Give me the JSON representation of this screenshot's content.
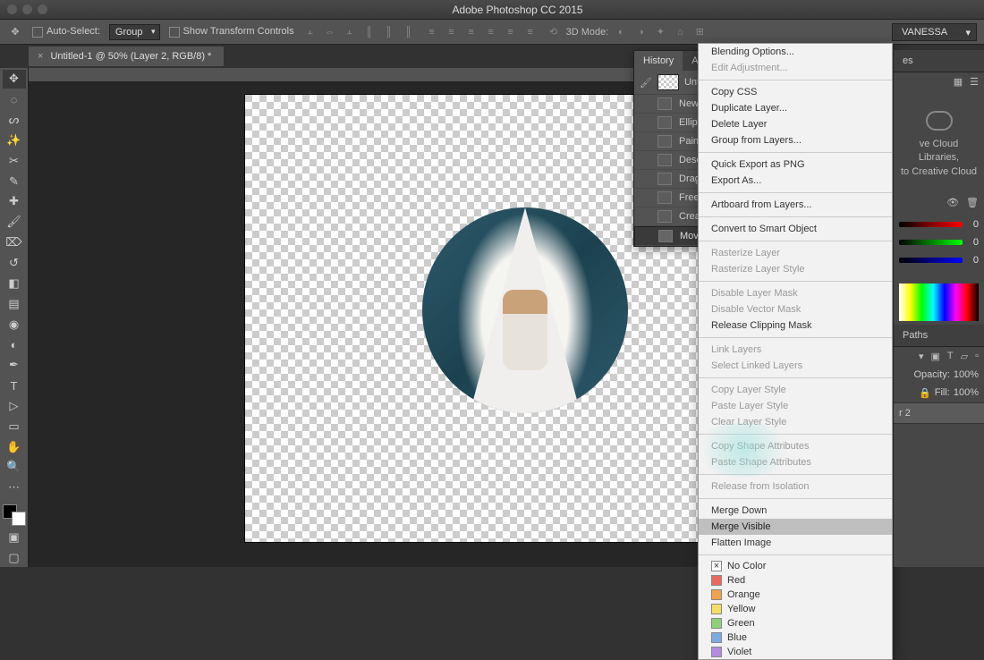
{
  "app": {
    "title": "Adobe Photoshop CC 2015"
  },
  "options_bar": {
    "auto_select_label": "Auto-Select:",
    "auto_select_mode": "Group",
    "show_transform_label": "Show Transform Controls",
    "mode_3d_label": "3D Mode:"
  },
  "workspace": {
    "current": "VANESSA"
  },
  "document_tab": {
    "label": "Untitled-1 @ 50% (Layer 2, RGB/8) *"
  },
  "history_panel": {
    "tabs": [
      "History",
      "Acti"
    ],
    "doc_name": "Untit",
    "items": [
      {
        "label": "New"
      },
      {
        "label": "Ellipti"
      },
      {
        "label": "Paint"
      },
      {
        "label": "Desel"
      },
      {
        "label": "Drag"
      },
      {
        "label": "Free T"
      },
      {
        "label": "Create"
      },
      {
        "label": "Move"
      }
    ]
  },
  "context_menu": {
    "items": [
      {
        "label": "Blending Options...",
        "enabled": true
      },
      {
        "label": "Edit Adjustment...",
        "enabled": false
      },
      {
        "sep": true
      },
      {
        "label": "Copy CSS",
        "enabled": true
      },
      {
        "label": "Duplicate Layer...",
        "enabled": true
      },
      {
        "label": "Delete Layer",
        "enabled": true
      },
      {
        "label": "Group from Layers...",
        "enabled": true
      },
      {
        "sep": true
      },
      {
        "label": "Quick Export as PNG",
        "enabled": true
      },
      {
        "label": "Export As...",
        "enabled": true
      },
      {
        "sep": true
      },
      {
        "label": "Artboard from Layers...",
        "enabled": true
      },
      {
        "sep": true
      },
      {
        "label": "Convert to Smart Object",
        "enabled": true
      },
      {
        "sep": true
      },
      {
        "label": "Rasterize Layer",
        "enabled": false
      },
      {
        "label": "Rasterize Layer Style",
        "enabled": false
      },
      {
        "sep": true
      },
      {
        "label": "Disable Layer Mask",
        "enabled": false
      },
      {
        "label": "Disable Vector Mask",
        "enabled": false
      },
      {
        "label": "Release Clipping Mask",
        "enabled": true
      },
      {
        "sep": true
      },
      {
        "label": "Link Layers",
        "enabled": false
      },
      {
        "label": "Select Linked Layers",
        "enabled": false
      },
      {
        "sep": true
      },
      {
        "label": "Copy Layer Style",
        "enabled": false
      },
      {
        "label": "Paste Layer Style",
        "enabled": false
      },
      {
        "label": "Clear Layer Style",
        "enabled": false
      },
      {
        "sep": true
      },
      {
        "label": "Copy Shape Attributes",
        "enabled": false
      },
      {
        "label": "Paste Shape Attributes",
        "enabled": false
      },
      {
        "sep": true
      },
      {
        "label": "Release from Isolation",
        "enabled": false
      },
      {
        "sep": true
      },
      {
        "label": "Merge Down",
        "enabled": true
      },
      {
        "label": "Merge Visible",
        "enabled": true,
        "highlight": true
      },
      {
        "label": "Flatten Image",
        "enabled": true
      },
      {
        "sep": true
      }
    ],
    "colors": [
      {
        "label": "No Color",
        "hex": "transparent",
        "x": true
      },
      {
        "label": "Red",
        "hex": "#e86b5c"
      },
      {
        "label": "Orange",
        "hex": "#f2a24a"
      },
      {
        "label": "Yellow",
        "hex": "#f5df63"
      },
      {
        "label": "Green",
        "hex": "#8fd17b"
      },
      {
        "label": "Blue",
        "hex": "#7da9e6"
      },
      {
        "label": "Violet",
        "hex": "#b48be0"
      }
    ]
  },
  "right_dock": {
    "tab_labels": [
      "es"
    ],
    "libraries_line1": "ve Cloud Libraries,",
    "libraries_line2": "to Creative Cloud",
    "paths_tab": "Paths",
    "opacity_label": "Opacity:",
    "opacity_value": "100%",
    "fill_label": "Fill:",
    "fill_value": "100%",
    "layer_name": "r 2",
    "rgb_value": "0",
    "slider_colors": [
      "#d32",
      "#2c4",
      "#36f"
    ]
  },
  "tools": [
    "move",
    "rect-marquee",
    "lasso",
    "magic-wand",
    "crop",
    "eyedropper",
    "spot-heal",
    "brush",
    "clone",
    "history-brush",
    "eraser",
    "gradient",
    "blur",
    "dodge",
    "pen",
    "type",
    "path-select",
    "rectangle",
    "hand",
    "zoom"
  ],
  "swatch": {
    "fg": "#000000",
    "bg": "#ffffff"
  }
}
